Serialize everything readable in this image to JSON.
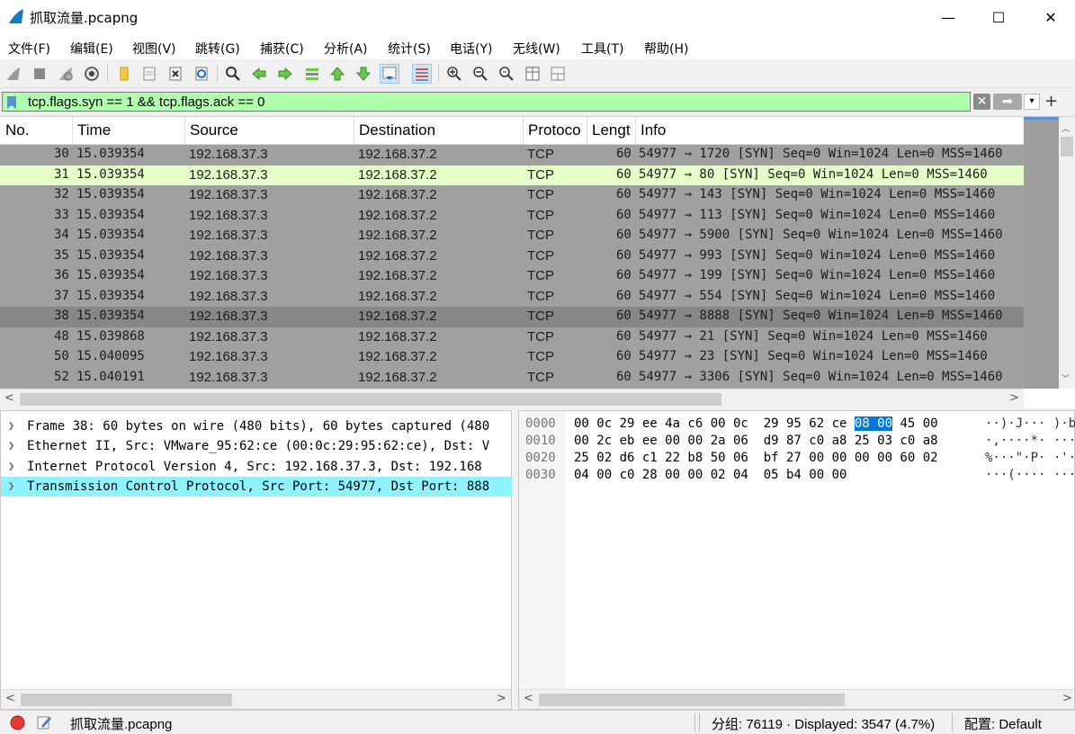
{
  "window": {
    "title": "抓取流量.pcapng",
    "minimize": "—",
    "maximize": "☐",
    "close": "✕"
  },
  "menu": [
    "文件(F)",
    "编辑(E)",
    "视图(V)",
    "跳转(G)",
    "捕获(C)",
    "分析(A)",
    "统计(S)",
    "电话(Y)",
    "无线(W)",
    "工具(T)",
    "帮助(H)"
  ],
  "filter": {
    "value": "tcp.flags.syn == 1 && tcp.flags.ack == 0",
    "clear": "✕",
    "apply": "➡",
    "dropdown": "▾",
    "add": "+"
  },
  "columns": [
    "No.",
    "Time",
    "Source",
    "Destination",
    "Protoco",
    "Lengt",
    "Info"
  ],
  "packets": [
    {
      "no": "30",
      "time": "15.039354",
      "src": "192.168.37.3",
      "dst": "192.168.37.2",
      "proto": "TCP",
      "len": "60",
      "info": "54977 → 1720 [SYN] Seq=0 Win=1024 Len=0 MSS=1460"
    },
    {
      "no": "31",
      "time": "15.039354",
      "src": "192.168.37.3",
      "dst": "192.168.37.2",
      "proto": "TCP",
      "len": "60",
      "info": "54977 → 80 [SYN] Seq=0 Win=1024 Len=0 MSS=1460"
    },
    {
      "no": "32",
      "time": "15.039354",
      "src": "192.168.37.3",
      "dst": "192.168.37.2",
      "proto": "TCP",
      "len": "60",
      "info": "54977 → 143 [SYN] Seq=0 Win=1024 Len=0 MSS=1460"
    },
    {
      "no": "33",
      "time": "15.039354",
      "src": "192.168.37.3",
      "dst": "192.168.37.2",
      "proto": "TCP",
      "len": "60",
      "info": "54977 → 113 [SYN] Seq=0 Win=1024 Len=0 MSS=1460"
    },
    {
      "no": "34",
      "time": "15.039354",
      "src": "192.168.37.3",
      "dst": "192.168.37.2",
      "proto": "TCP",
      "len": "60",
      "info": "54977 → 5900 [SYN] Seq=0 Win=1024 Len=0 MSS=1460"
    },
    {
      "no": "35",
      "time": "15.039354",
      "src": "192.168.37.3",
      "dst": "192.168.37.2",
      "proto": "TCP",
      "len": "60",
      "info": "54977 → 993 [SYN] Seq=0 Win=1024 Len=0 MSS=1460"
    },
    {
      "no": "36",
      "time": "15.039354",
      "src": "192.168.37.3",
      "dst": "192.168.37.2",
      "proto": "TCP",
      "len": "60",
      "info": "54977 → 199 [SYN] Seq=0 Win=1024 Len=0 MSS=1460"
    },
    {
      "no": "37",
      "time": "15.039354",
      "src": "192.168.37.3",
      "dst": "192.168.37.2",
      "proto": "TCP",
      "len": "60",
      "info": "54977 → 554 [SYN] Seq=0 Win=1024 Len=0 MSS=1460"
    },
    {
      "no": "38",
      "time": "15.039354",
      "src": "192.168.37.3",
      "dst": "192.168.37.2",
      "proto": "TCP",
      "len": "60",
      "info": "54977 → 8888 [SYN] Seq=0 Win=1024 Len=0 MSS=1460"
    },
    {
      "no": "48",
      "time": "15.039868",
      "src": "192.168.37.3",
      "dst": "192.168.37.2",
      "proto": "TCP",
      "len": "60",
      "info": "54977 → 21 [SYN] Seq=0 Win=1024 Len=0 MSS=1460"
    },
    {
      "no": "50",
      "time": "15.040095",
      "src": "192.168.37.3",
      "dst": "192.168.37.2",
      "proto": "TCP",
      "len": "60",
      "info": "54977 → 23 [SYN] Seq=0 Win=1024 Len=0 MSS=1460"
    },
    {
      "no": "52",
      "time": "15.040191",
      "src": "192.168.37.3",
      "dst": "192.168.37.2",
      "proto": "TCP",
      "len": "60",
      "info": "54977 → 3306 [SYN] Seq=0 Win=1024 Len=0 MSS=1460"
    }
  ],
  "details": [
    "Frame 38: 60 bytes on wire (480 bits), 60 bytes captured (480",
    "Ethernet II, Src: VMware_95:62:ce (00:0c:29:95:62:ce), Dst: V",
    "Internet Protocol Version 4, Src: 192.168.37.3, Dst: 192.168",
    "Transmission Control Protocol, Src Port: 54977, Dst Port: 888"
  ],
  "hex": [
    {
      "off": "0000",
      "pre": "00 0c 29 ee 4a c6 00 0c  29 95 62 ce ",
      "hl": "08 00",
      "post": " 45 00",
      "ascii": "··)·J··· )·b"
    },
    {
      "off": "0010",
      "pre": "00 2c eb ee 00 00 2a 06  d9 87 c0 a8 25 03 c0 a8",
      "hl": "",
      "post": "",
      "ascii": "·,····*· ····"
    },
    {
      "off": "0020",
      "pre": "25 02 d6 c1 22 b8 50 06  bf 27 00 00 00 00 60 02",
      "hl": "",
      "post": "",
      "ascii": "%···\"·P· ·'··"
    },
    {
      "off": "0030",
      "pre": "04 00 c0 28 00 00 02 04  05 b4 00 00",
      "hl": "",
      "post": "",
      "ascii": "···(···· ····"
    }
  ],
  "status": {
    "file": "抓取流量.pcapng",
    "packets": "分组: 76119 · Displayed: 3547 (4.7%)",
    "profile": "配置: Default"
  },
  "colors": {
    "filter_ok": "#afffaf",
    "row_gray": "#a0a0a0",
    "row_selected_green": "#e4ffc7",
    "row_dark": "#878787",
    "detail_selected": "#8ef3ff",
    "hex_highlight": "#0078d7"
  }
}
